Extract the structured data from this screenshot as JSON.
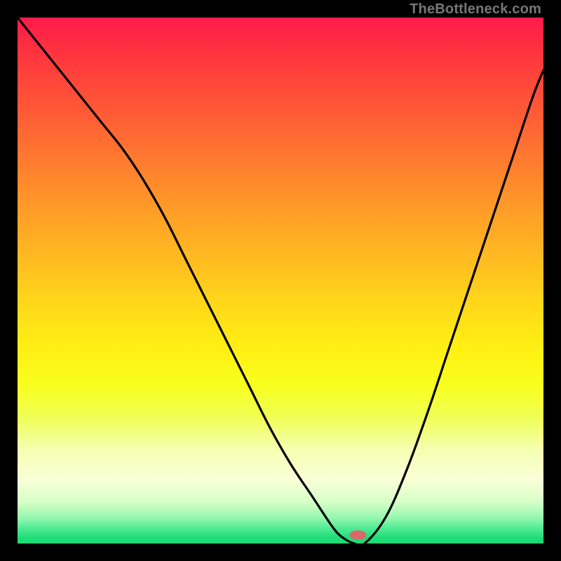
{
  "watermark": "TheBottleneck.com",
  "chart_data": {
    "type": "line",
    "title": "",
    "xlabel": "",
    "ylabel": "",
    "xlim": [
      0,
      100
    ],
    "ylim": [
      0,
      100
    ],
    "grid": false,
    "legend": false,
    "series": [
      {
        "name": "bottleneck-curve",
        "x": [
          0,
          4,
          8,
          12,
          16,
          20,
          24,
          28,
          32,
          36,
          40,
          44,
          48,
          52,
          56,
          60,
          62,
          64,
          66,
          70,
          74,
          78,
          82,
          86,
          90,
          94,
          98,
          100
        ],
        "values": [
          100,
          95,
          90,
          85,
          80,
          75,
          69,
          62,
          54,
          46,
          38,
          30,
          22,
          15,
          9,
          3,
          1,
          0,
          0,
          5,
          14,
          25,
          37,
          49,
          61,
          73,
          85,
          90
        ]
      }
    ],
    "marker": {
      "x": 64.7,
      "y": 1.6,
      "rx": 1.6,
      "ry": 0.9,
      "color": "#d86a6a",
      "name": "bottleneck-point"
    },
    "background_gradient": {
      "direction": "vertical",
      "stops": [
        {
          "pos": 0.0,
          "color": "#ff1a4a"
        },
        {
          "pos": 0.18,
          "color": "#ff5a36"
        },
        {
          "pos": 0.36,
          "color": "#ff9a28"
        },
        {
          "pos": 0.54,
          "color": "#ffd61a"
        },
        {
          "pos": 0.7,
          "color": "#f8ff1e"
        },
        {
          "pos": 0.88,
          "color": "#f8ffd8"
        },
        {
          "pos": 0.95,
          "color": "#98f8b0"
        },
        {
          "pos": 1.0,
          "color": "#1ddc76"
        }
      ]
    }
  }
}
